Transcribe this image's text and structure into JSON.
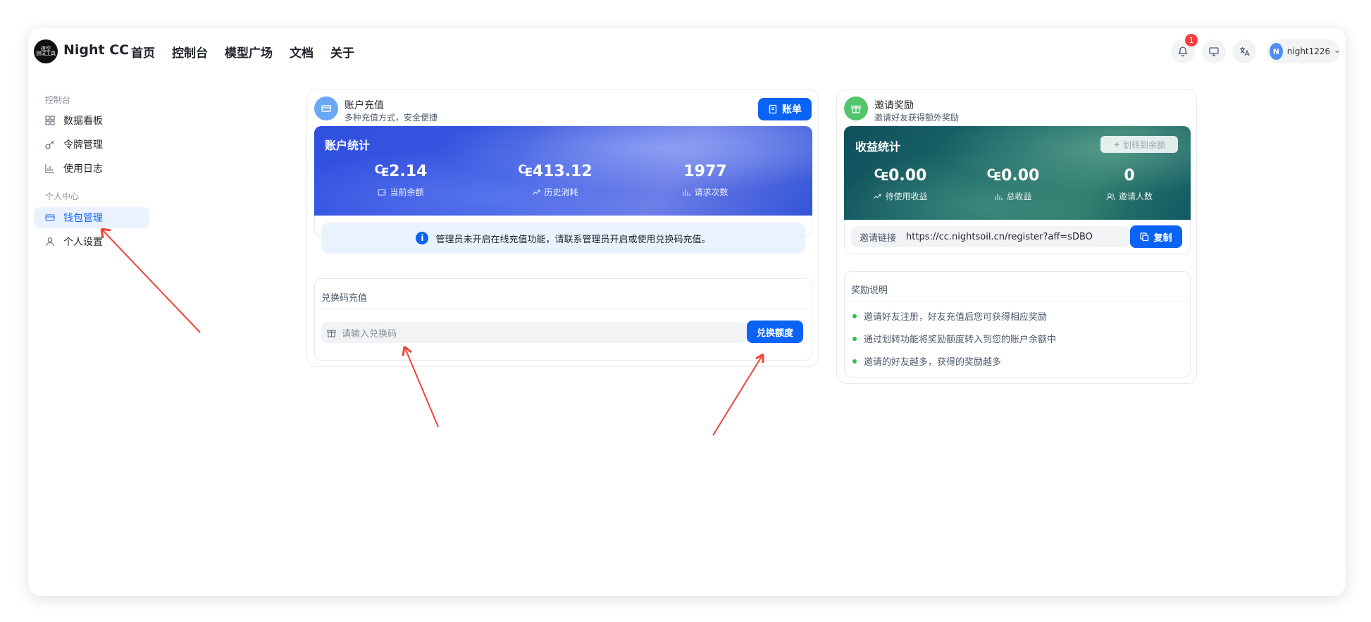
{
  "header": {
    "brand": "Night CC",
    "logo_text": "夜空\n测试工具",
    "nav": [
      "首页",
      "控制台",
      "模型广场",
      "文档",
      "关于"
    ],
    "notification_count": "1",
    "user": {
      "avatar_letter": "N",
      "name": "night1226"
    }
  },
  "sidebar": {
    "group1": "控制台",
    "items1": [
      "数据看板",
      "令牌管理",
      "使用日志"
    ],
    "group2": "个人中心",
    "items2": [
      "钱包管理",
      "个人设置"
    ],
    "active": "钱包管理"
  },
  "recharge": {
    "title": "账户充值",
    "subtitle": "多种充值方式，安全便捷",
    "bill_label": "账单",
    "stats_title": "账户统计",
    "stats": [
      {
        "value": "₠2.14",
        "label": "当前余额"
      },
      {
        "value": "₠413.12",
        "label": "历史消耗"
      },
      {
        "value": "1977",
        "label": "请求次数"
      }
    ],
    "notice": "管理员未开启在线充值功能，请联系管理员开启或使用兑换码充值。",
    "redeem_title": "兑换码充值",
    "redeem_placeholder": "请输入兑换码",
    "redeem_button": "兑换额度"
  },
  "invite": {
    "title": "邀请奖励",
    "subtitle": "邀请好友获得额外奖励",
    "stats_title": "收益统计",
    "transfer_label": "划转到余额",
    "stats": [
      {
        "value": "₠0.00",
        "label": "待使用收益"
      },
      {
        "value": "₠0.00",
        "label": "总收益"
      },
      {
        "value": "0",
        "label": "邀请人数"
      }
    ],
    "link_label": "邀请链接",
    "link_value": "https://cc.nightsoil.cn/register?aff=sDBO",
    "copy_label": "复制",
    "rules_title": "奖励说明",
    "rules": [
      "邀请好友注册，好友充值后您可获得相应奖励",
      "通过划转功能将奖励额度转入到您的账户余额中",
      "邀请的好友越多，获得的奖励越多"
    ]
  },
  "colors": {
    "primary": "#0b63f5",
    "recharge_panel": "#3a57de",
    "invite_panel": "#1d6a6a",
    "annotation": "#f04438"
  }
}
